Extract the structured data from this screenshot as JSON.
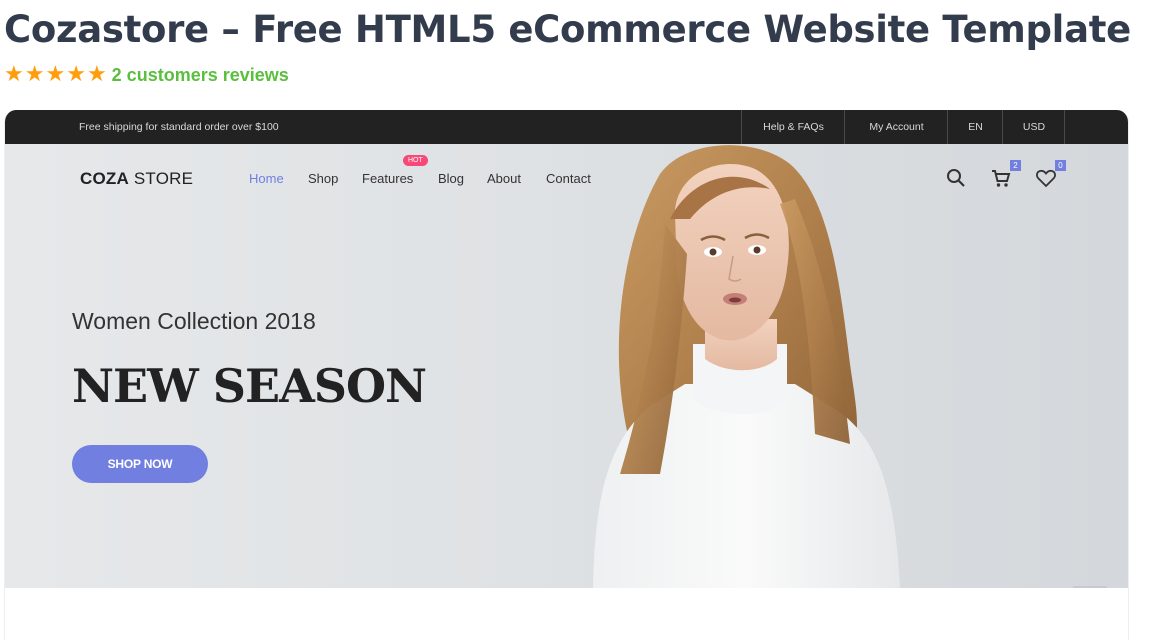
{
  "page": {
    "title": "Cozastore – Free HTML5 eCommerce Website Template",
    "rating": {
      "stars": 5,
      "reviews_text": "2 customers reviews"
    }
  },
  "preview": {
    "topbar": {
      "shipping_text": "Free shipping for standard order over $100",
      "links": [
        "Help & FAQs",
        "My Account",
        "EN",
        "USD"
      ]
    },
    "header": {
      "logo_bold": "COZA",
      "logo_light": " STORE",
      "nav": [
        "Home",
        "Shop",
        "Features",
        "Blog",
        "About",
        "Contact"
      ],
      "active_nav": "Home",
      "hot_badge": "HOT",
      "cart_count": "2",
      "wishlist_count": "0"
    },
    "hero": {
      "subtitle": "Women Collection 2018",
      "headline": "NEW SEASON",
      "cta": "SHOP NOW"
    }
  },
  "colors": {
    "accent": "#717fe0",
    "hot": "#f74877",
    "star": "#ff9e0a",
    "reviews": "#5bbf3e",
    "topbar": "#222222"
  },
  "icons": [
    "star-icon",
    "search-icon",
    "cart-icon",
    "heart-icon"
  ]
}
